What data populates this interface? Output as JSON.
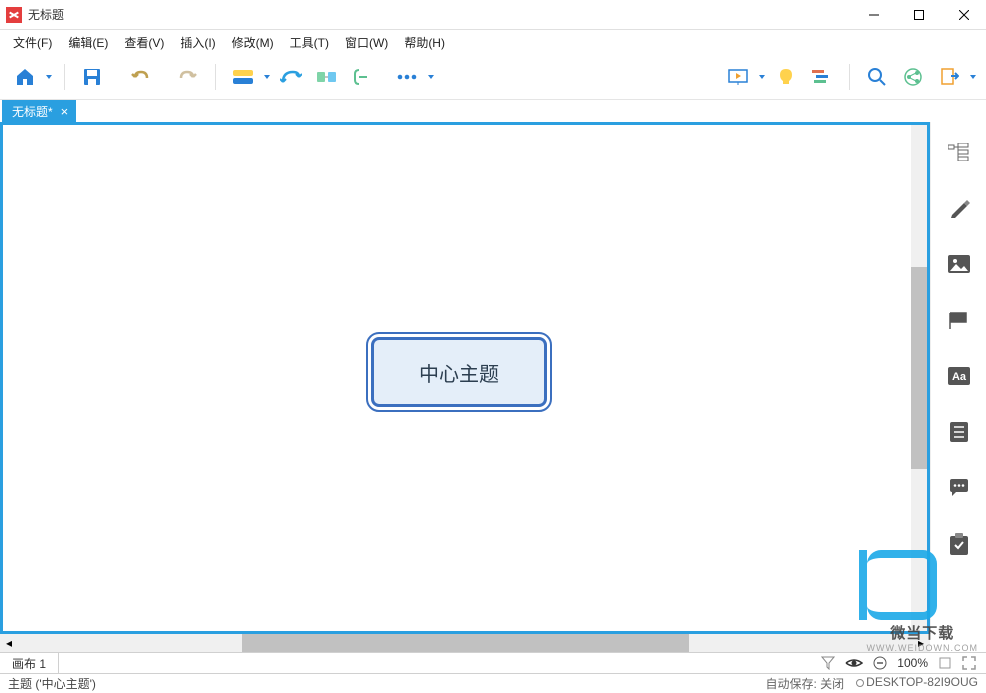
{
  "window": {
    "title": "无标题"
  },
  "menu": {
    "file": "文件(F)",
    "edit": "编辑(E)",
    "view": "查看(V)",
    "insert": "插入(I)",
    "modify": "修改(M)",
    "tools": "工具(T)",
    "window": "窗口(W)",
    "help": "帮助(H)"
  },
  "tab": {
    "label": "无标题*"
  },
  "canvas": {
    "center_topic": "中心主题"
  },
  "sheet": {
    "name": "画布 1"
  },
  "zoombar": {
    "zoom": "100%"
  },
  "status": {
    "selection": "主题 ('中心主题')",
    "autosave": "自动保存: 关闭",
    "hostname": "DESKTOP-82I9OUG"
  },
  "watermark": {
    "brand": "微当下载",
    "url": "WWW.WEIDOWN.COM"
  }
}
